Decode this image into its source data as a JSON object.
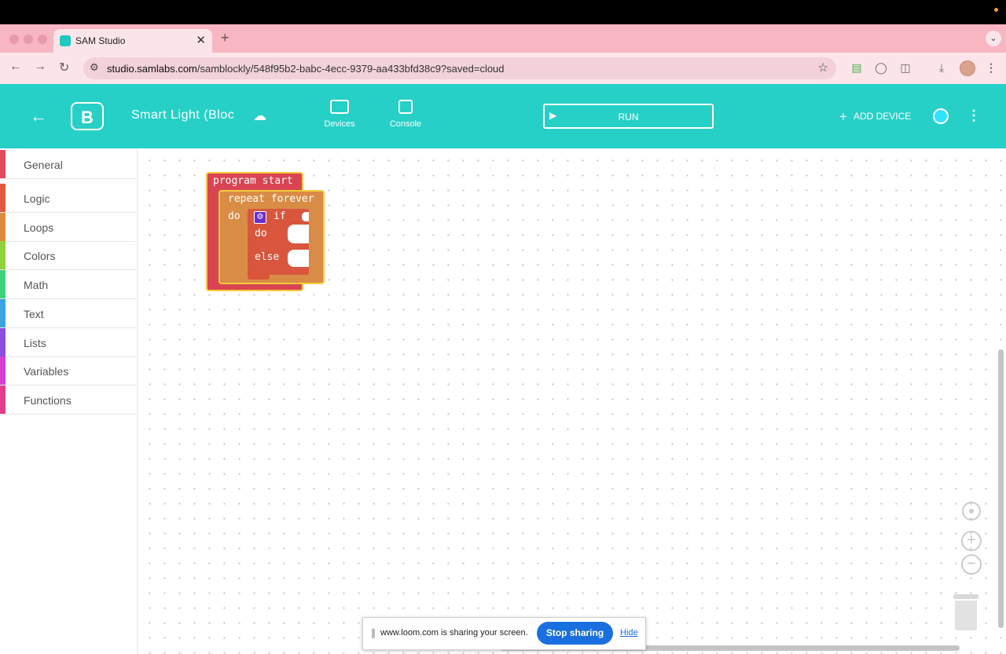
{
  "browser": {
    "tab_title": "SAM Studio",
    "tab_close": "✕",
    "new_tab": "+",
    "url_host": "studio.samlabs.com",
    "url_path": "/samblockly/548f95b2-babc-4ecc-9379-aa433bfd38c9?saved=cloud"
  },
  "header": {
    "project_title": "Smart Light (Blocks)",
    "nav_devices": "Devices",
    "nav_console": "Console",
    "run_label": "RUN",
    "add_device_label": "ADD DEVICE"
  },
  "sidebar": {
    "categories": [
      {
        "label": "General",
        "color": "#e04a5a"
      },
      {
        "label": "Logic",
        "color": "#e05a3e"
      },
      {
        "label": "Loops",
        "color": "#e08c3e"
      },
      {
        "label": "Colors",
        "color": "#8fd13e"
      },
      {
        "label": "Math",
        "color": "#3ed17c"
      },
      {
        "label": "Text",
        "color": "#3ea3e0"
      },
      {
        "label": "Lists",
        "color": "#8a4ee0"
      },
      {
        "label": "Variables",
        "color": "#d63ed1"
      },
      {
        "label": "Functions",
        "color": "#e03e8c"
      }
    ]
  },
  "blocks": {
    "program_start": "program start",
    "repeat_forever": "repeat forever",
    "repeat_do": "do",
    "if_label": "if",
    "if_do": "do",
    "if_else": "else"
  },
  "colors": {
    "app_teal": "#26d0c6",
    "program_block": "#d94452",
    "loop_block": "#d98c45",
    "logic_block": "#d9553c",
    "highlight": "#f6cc3a"
  },
  "loom": {
    "message": "www.loom.com is sharing your screen.",
    "stop_label": "Stop sharing",
    "hide_label": "Hide"
  }
}
